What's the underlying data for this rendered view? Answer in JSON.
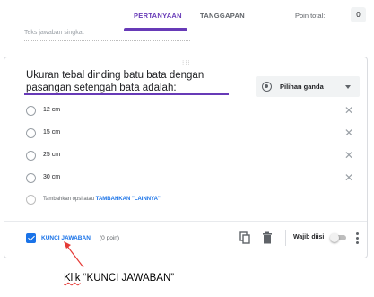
{
  "tabs": [
    {
      "label": "PERTANYAAN",
      "active": true
    },
    {
      "label": "TANGGAPAN",
      "active": false
    }
  ],
  "points_total": {
    "label": "Poin total:",
    "value": "0"
  },
  "short_answer_placeholder": "Teks jawaban singkat",
  "question": {
    "text": "Ukuran tebal dinding batu bata dengan pasangan setengah bata adalah:",
    "type_label": "Pilihan ganda"
  },
  "options": [
    {
      "label": "12 cm"
    },
    {
      "label": "15 cm"
    },
    {
      "label": "25 cm"
    },
    {
      "label": "30 cm"
    }
  ],
  "add_option": {
    "text": "Tambahkan opsi",
    "or": "atau",
    "other_link": "TAMBAHKAN \"LAINNYA\""
  },
  "footer": {
    "answer_key_label": "KUNCI JAWABAN",
    "answer_key_points": "(0 poin)",
    "required_label": "Wajib diisi"
  },
  "annotation": {
    "prefix": "Klik",
    "rest": " “KUNCI JAWABAN”"
  },
  "colors": {
    "accent": "#673ab7",
    "link": "#1a73e8",
    "arrow": "#e53935"
  }
}
